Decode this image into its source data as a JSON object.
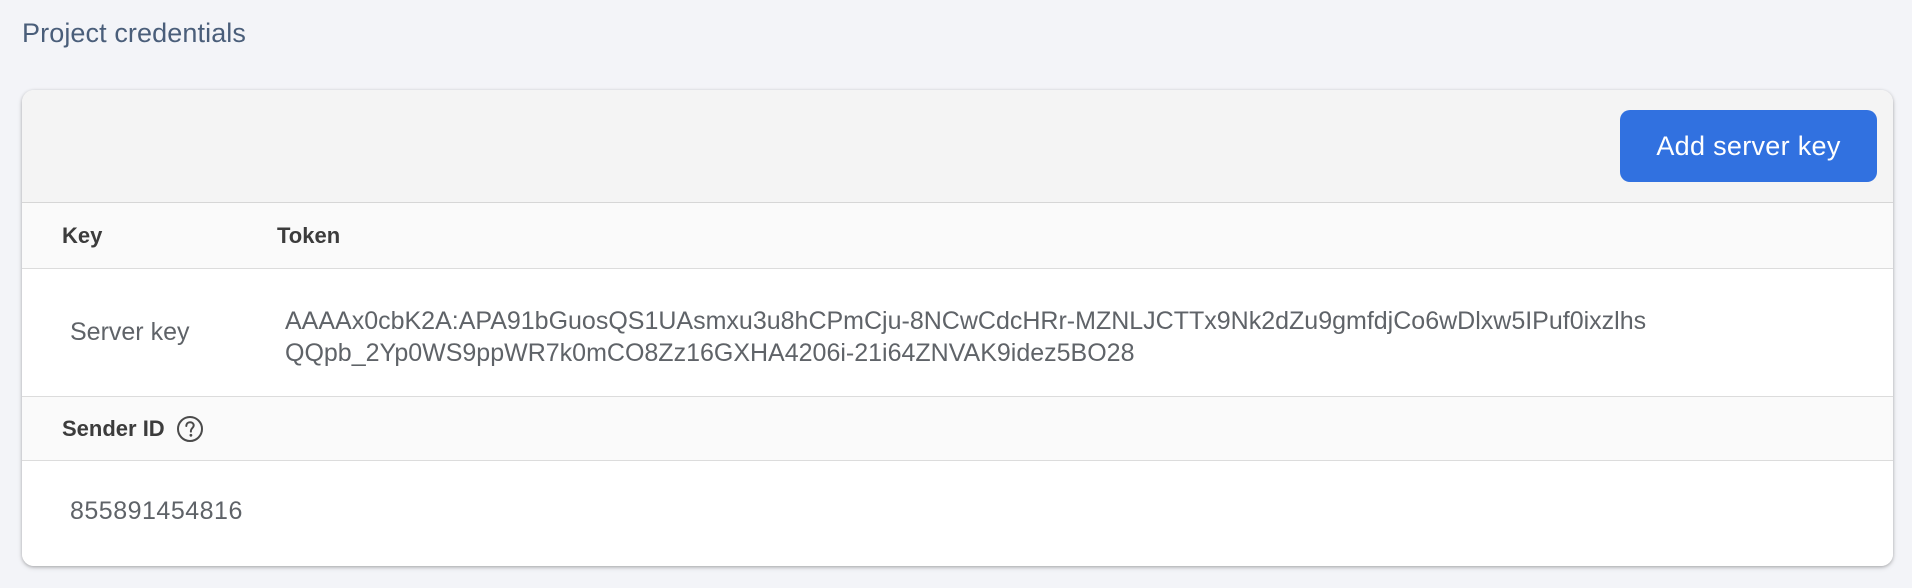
{
  "page": {
    "section_title": "Project credentials"
  },
  "toolbar": {
    "add_button_label": "Add server key"
  },
  "table": {
    "columns": [
      "Key",
      "Token"
    ],
    "rows": [
      {
        "key": "Server key",
        "token_lines": [
          "AAAAx0cbK2A:APA91bGuosQS1UAsmxu3u8hCPmCju-8NCwCdcHRr-MZNLJCTTx9Nk2dZu9gmfdjCo6wDlxw5IPuf0ixzlhs",
          "QQpb_2Yp0WS9ppWR7k0mCO8Zz16GXHA4206i-21i64ZNVAK9idez5BO28"
        ]
      }
    ]
  },
  "sender": {
    "label": "Sender ID",
    "help_icon": "help-circle-icon",
    "value": "855891454816"
  },
  "colors": {
    "accent": "#3171e0",
    "page_background": "#f3f4f8",
    "title": "#4a5e7a",
    "text_muted": "#5f6368"
  }
}
